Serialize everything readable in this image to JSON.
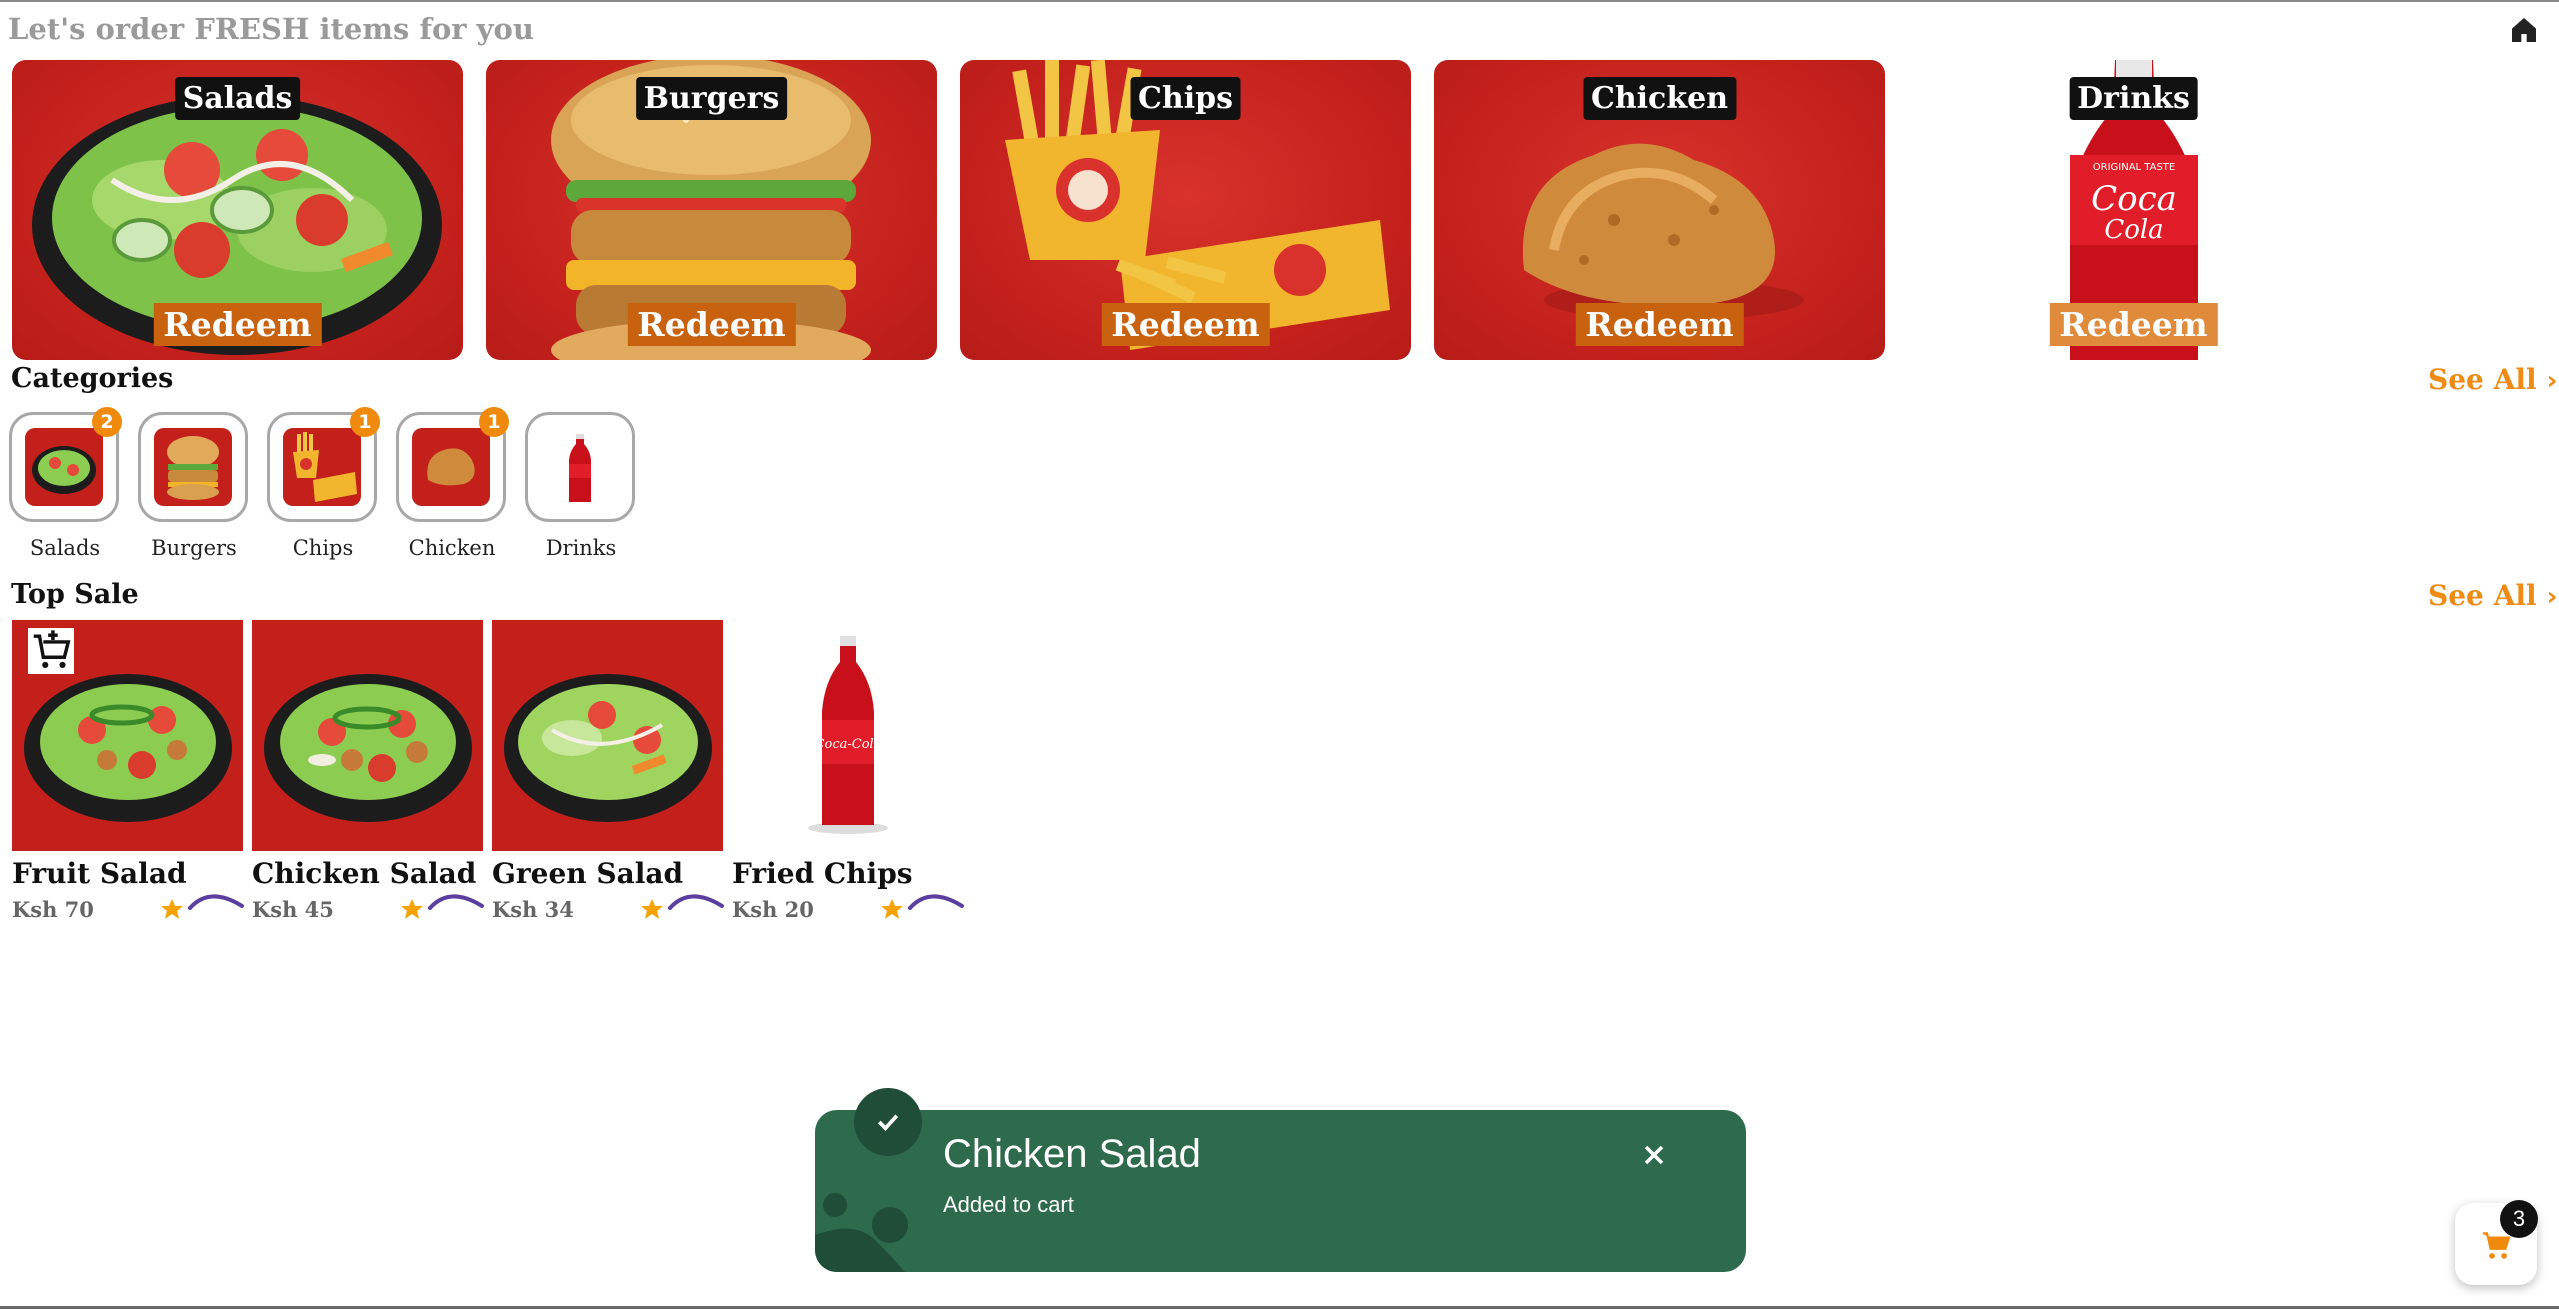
{
  "header": {
    "title": "Let's order FRESH items for you",
    "home_icon": "home-icon"
  },
  "banners": [
    {
      "label": "Salads",
      "action": "Redeem",
      "bg": "red"
    },
    {
      "label": "Burgers",
      "action": "Redeem",
      "bg": "red"
    },
    {
      "label": "Chips",
      "action": "Redeem",
      "bg": "red"
    },
    {
      "label": "Chicken",
      "action": "Redeem",
      "bg": "red"
    },
    {
      "label": "Drinks",
      "action": "Redeem",
      "bg": "white"
    }
  ],
  "categories": {
    "title": "Categories",
    "see_all": "See All",
    "items": [
      {
        "label": "Salads",
        "badge": "2"
      },
      {
        "label": "Burgers",
        "badge": ""
      },
      {
        "label": "Chips",
        "badge": "1"
      },
      {
        "label": "Chicken",
        "badge": "1"
      },
      {
        "label": "Drinks",
        "badge": ""
      }
    ]
  },
  "top_sale": {
    "title": "Top Sale",
    "see_all": "See All",
    "items": [
      {
        "name": "Fruit Salad",
        "price": "Ksh 70"
      },
      {
        "name": "Chicken Salad",
        "price": "Ksh 45"
      },
      {
        "name": "Green Salad",
        "price": "Ksh 34"
      },
      {
        "name": "Fried Chips",
        "price": "Ksh 20"
      }
    ]
  },
  "toast": {
    "title": "Chicken Salad",
    "message": "Added to cart"
  },
  "cart": {
    "count": "3",
    "icon": "cart-icon"
  },
  "colors": {
    "brand_red": "#c3201c",
    "accent_orange": "#ef8a12",
    "toast_green": "#2e6b4d",
    "badge_orange": "#f08a0c",
    "star": "#f5a300",
    "spinner": "#5b3fa0"
  }
}
